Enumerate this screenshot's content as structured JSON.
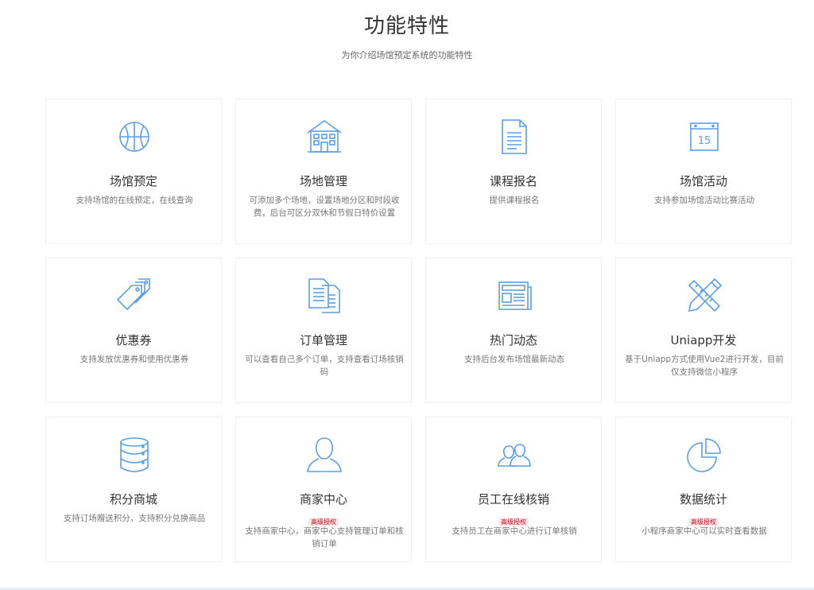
{
  "section": {
    "title": "功能特性",
    "subtitle": "为你介绍场馆预定系统的功能特性"
  },
  "accent_color": "#5b9ee8",
  "badge_color": "#d0021b",
  "features": [
    {
      "icon": "basketball-icon",
      "title": "场馆预定",
      "desc": "支持场馆的在线预定，在线查询"
    },
    {
      "icon": "building-icon",
      "title": "场地管理",
      "desc": "可添加多个场地，设置场地分区和时段收费，后台可区分双休和节假日特价设置"
    },
    {
      "icon": "document-icon",
      "title": "课程报名",
      "desc": "提供课程报名"
    },
    {
      "icon": "calendar-icon",
      "title": "场馆活动",
      "desc": "支持参加场馆活动比赛活动",
      "calendar_day": "15"
    },
    {
      "icon": "tags-icon",
      "title": "优惠券",
      "desc": "支持发放优惠券和使用优惠券"
    },
    {
      "icon": "documents-icon",
      "title": "订单管理",
      "desc": "可以查看自己多个订单，支持查看订场核销码"
    },
    {
      "icon": "newspaper-icon",
      "title": "热门动态",
      "desc": "支持后台发布场馆最新动态"
    },
    {
      "icon": "ruler-pencil-icon",
      "title": "Uniapp开发",
      "desc": "基于Uniapp方式使用Vue2进行开发，目前仅支持微信小程序"
    },
    {
      "icon": "database-icon",
      "title": "积分商城",
      "desc": "支持订场赠送积分，支持积分兑换商品"
    },
    {
      "icon": "user-icon",
      "title": "商家中心",
      "badge": "高级授权",
      "desc": "支持商家中心，商家中心支持管理订单和核销订单"
    },
    {
      "icon": "users-icon",
      "title": "员工在线核销",
      "badge": "高级授权",
      "desc": "支持员工在商家中心进行订单核销"
    },
    {
      "icon": "pie-chart-icon",
      "title": "数据统计",
      "badge": "高级授权",
      "desc": "小程序商家中心可以实时查看数据"
    }
  ]
}
